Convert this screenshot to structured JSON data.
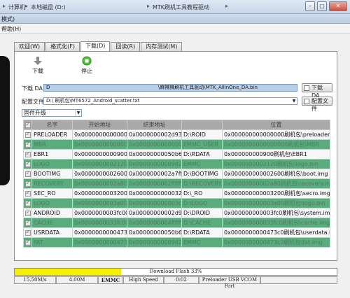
{
  "explorer": {
    "crumbs": [
      "计算机",
      "本地磁盘 (D:)",
      "MTK刷机工具教程驱动"
    ]
  },
  "window": {
    "title": "模式)"
  },
  "menu": {
    "help": "帮助(H)"
  },
  "tabs": [
    {
      "label": "欢迎(W)",
      "active": false
    },
    {
      "label": "格式化(F)",
      "active": false
    },
    {
      "label": "下载(D)",
      "active": true
    },
    {
      "label": "回读(R)",
      "active": false
    },
    {
      "label": "内存测试(M)",
      "active": false
    }
  ],
  "toolbar": {
    "download_label": "下载",
    "stop_label": "停止"
  },
  "download_agent": {
    "label": "下载 DA",
    "value_prefix": "D",
    "value_suffix": "\\麻辣辣刷机工具驱动\\MTK_AllInOne_DA.bin",
    "button": "下载 DA"
  },
  "scatter": {
    "label": "配置文件",
    "value": "D:\\                        刷机包\\MT6572_Android_scatter.txt",
    "button": "配置文件"
  },
  "mode_select": {
    "value": "固件升级"
  },
  "table": {
    "headers": [
      "名字",
      "开始地址",
      "结束地址",
      "",
      "位置"
    ],
    "rows": [
      {
        "name": "PRELOADER",
        "begin": "0x0000000000000000",
        "end": "0x0000000002d93bbb7",
        "region": "D:\\ROID",
        "location": "0x000000000000000刷机包\\preloader_gionee72_...",
        "style": "w"
      },
      {
        "name": "MBR",
        "begin": "0x0000000000000000",
        "end": "0x00000000000001ff",
        "region": "EMMC_USER",
        "location": "0x0000000000000000刷机包\\MBR",
        "style": "g"
      },
      {
        "name": "EBR1",
        "begin": "0x0000000000900000",
        "end": "0x00000000050b6f24f",
        "region": "D:\\RDATA",
        "location": "0x000000000900刷机包\\EBR1",
        "style": "w"
      },
      {
        "name": "LOGO",
        "begin": "0x0000000002120000",
        "end": "0x000000000094226279",
        "region": "EMMC",
        "location": "0x0000000002120刷机包\\logo.bin",
        "style": "g"
      },
      {
        "name": "BOOTIMG",
        "begin": "0x0000000002600000",
        "end": "0x0000000002a7ffff",
        "region": "D:\\BOOTIMG",
        "location": "0x000000000002600刷机包\\boot.img",
        "style": "w"
      },
      {
        "name": "RECOVERY",
        "begin": "0x0000000002a80000",
        "end": "0x0000000002ffffff",
        "region": "D:\\RECOVERY",
        "location": "0x00000000002a80刷机包\\recovery.img",
        "style": "g"
      },
      {
        "name": "SEC_RO",
        "begin": "0x0000000003200000",
        "end": "0x000000000003220fff",
        "region": "D:\\_RO",
        "location": "0x000000000003200刷机包\\secro.img",
        "style": "w"
      },
      {
        "name": "LOGO",
        "begin": "0x0000000003a00000",
        "end": "0x000000000003cfffff",
        "region": "D:\\LOGO",
        "location": "0x000000000003a00刷机包\\logo.bin",
        "style": "g"
      },
      {
        "name": "ANDROID",
        "begin": "0x0000000003fc0000",
        "end": "0x00000000002d93bbb7",
        "region": "D:\\DROID",
        "location": "0x000000000003fc0刷机包\\system.img",
        "style": "w"
      },
      {
        "name": "CACHE",
        "begin": "0x0000000033fc0000",
        "end": "0x0000000004ffffff",
        "region": "D:\\CACHE",
        "location": "0x000000000033fc0刷机包\\cache.img",
        "style": "g"
      },
      {
        "name": "USRDATA",
        "begin": "0x0000000000473c0000",
        "end": "0x00000000050b6f24f",
        "region": "D:\\RDATA",
        "location": "0x0000000000473c0刷机包\\userdata.img",
        "style": "w"
      },
      {
        "name": "FAT",
        "begin": "0x0000000000473c0000",
        "end": "0x000000000094226279",
        "region": "EMMC",
        "location": "0x0000000000473c0刷机包\\fat.img",
        "style": "g"
      }
    ]
  },
  "progress": {
    "text": "Download Flash 33%",
    "fraction": 0.33
  },
  "status": {
    "speed": "15.50M/s",
    "size": "4.00M",
    "storage": "EMMC",
    "usb_speed": "High Speed",
    "time": "0:02",
    "port": "Preloader USB VCOM Port"
  },
  "colors": {
    "progress_fill": "#f4f000",
    "row_highlight": "#5aab7d",
    "header": "#a9a9a9",
    "field_highlight": "#b8cde8"
  }
}
